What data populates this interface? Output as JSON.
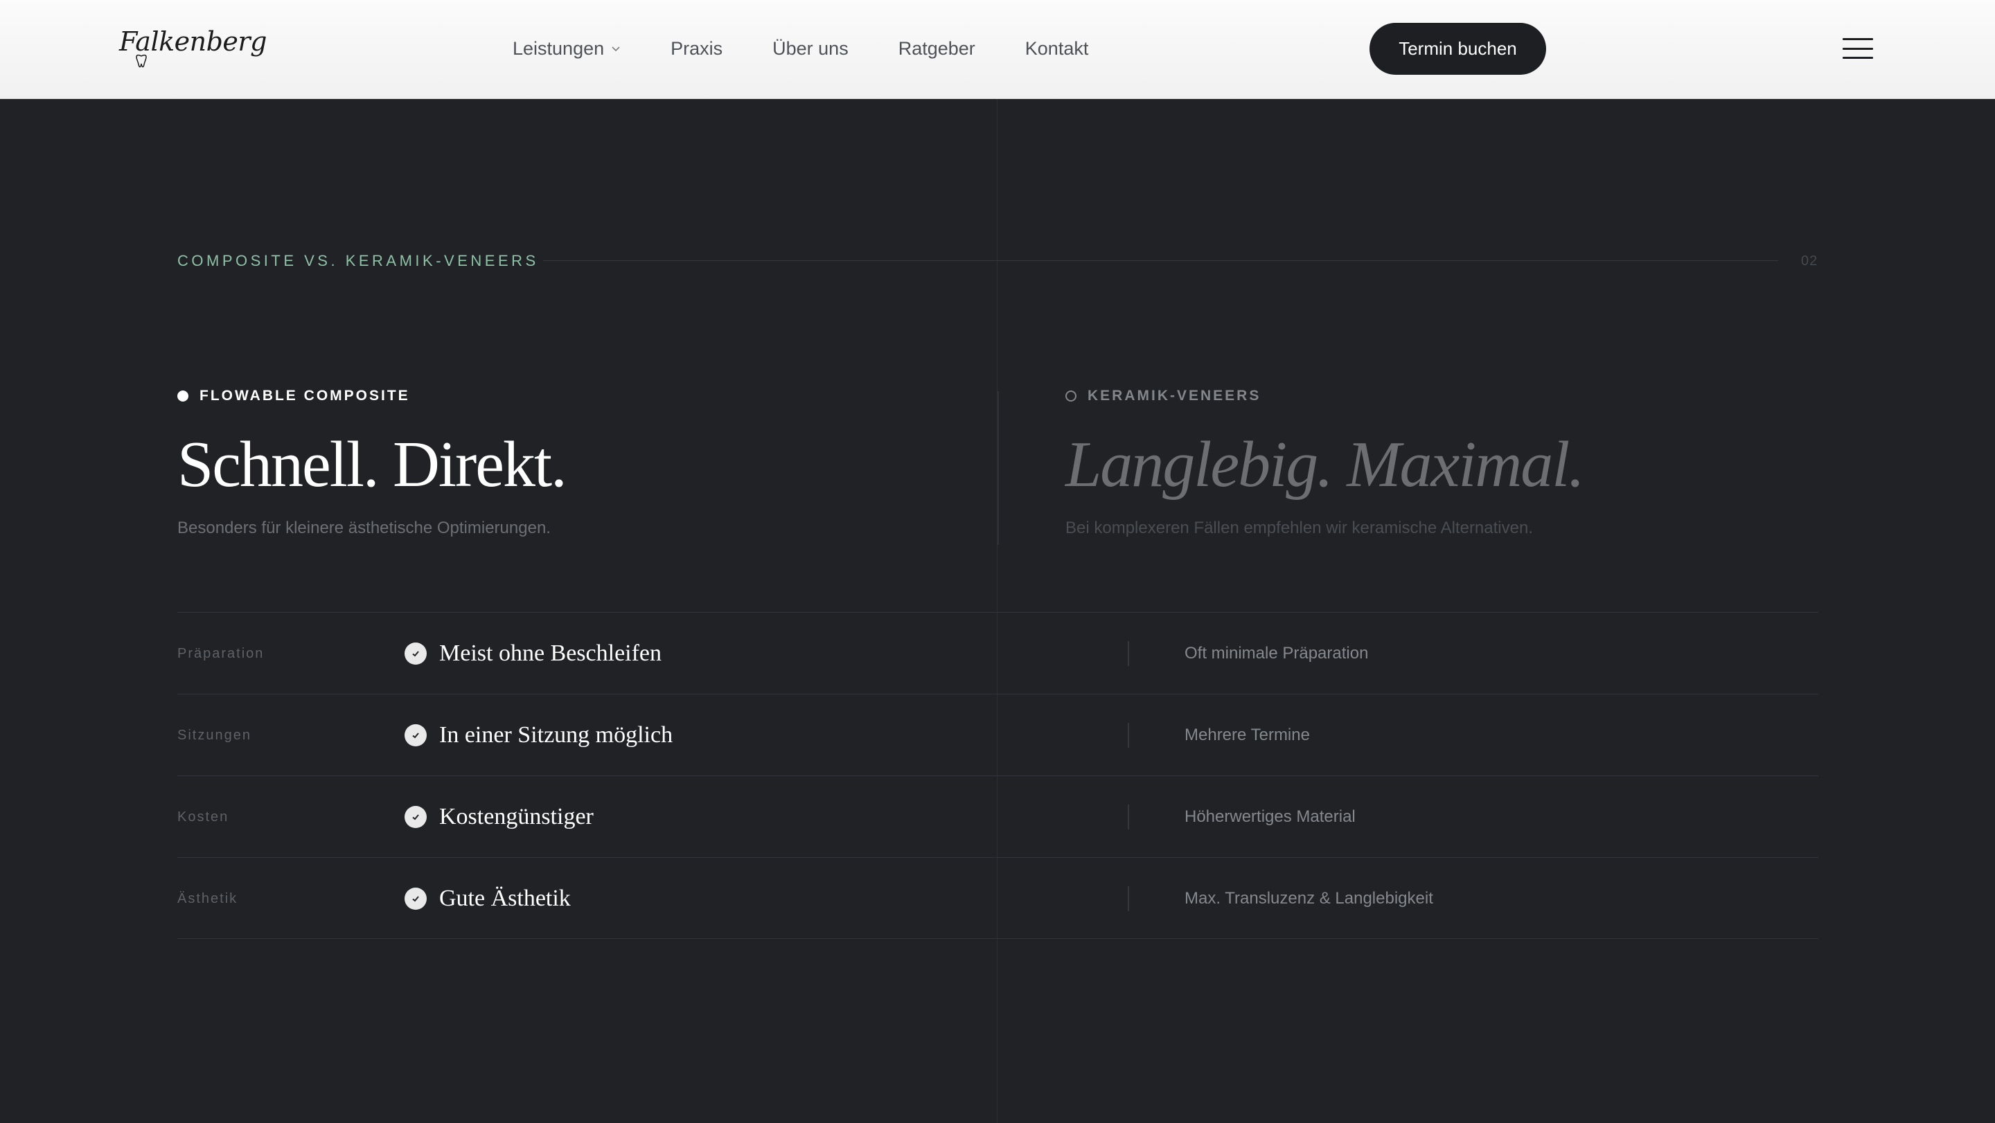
{
  "header": {
    "logo_text": "Falkenberg",
    "nav": [
      {
        "label": "Leistungen",
        "has_dropdown": true
      },
      {
        "label": "Praxis"
      },
      {
        "label": "Über uns"
      },
      {
        "label": "Ratgeber"
      },
      {
        "label": "Kontakt"
      }
    ],
    "cta_label": "Termin buchen"
  },
  "section": {
    "label": "COMPOSITE VS. KERAMIK-VENEERS",
    "number": "02"
  },
  "left": {
    "tag": "FLOWABLE COMPOSITE",
    "heading": "Schnell. Direkt.",
    "sub": "Besonders für kleinere ästhetische Optimierungen."
  },
  "right": {
    "tag": "KERAMIK-VENEERS",
    "heading": "Langlebig. Maximal.",
    "sub": "Bei komplexeren Fällen empfehlen wir keramische Alternativen."
  },
  "rows": [
    {
      "label": "Präparation",
      "left": "Meist ohne Beschleifen",
      "right": "Oft minimale Präparation"
    },
    {
      "label": "Sitzungen",
      "left": "In einer Sitzung möglich",
      "right": "Mehrere Termine"
    },
    {
      "label": "Kosten",
      "left": "Kostengünstiger",
      "right": "Höherwertiges Material"
    },
    {
      "label": "Ästhetik",
      "left": "Gute Ästhetik",
      "right": "Max. Transluzenz & Langlebigkeit"
    }
  ],
  "colors": {
    "background": "#202226",
    "accent": "#8ec2a6",
    "header_bg": "#f6f6f7",
    "cta_bg": "#1d1f23"
  }
}
